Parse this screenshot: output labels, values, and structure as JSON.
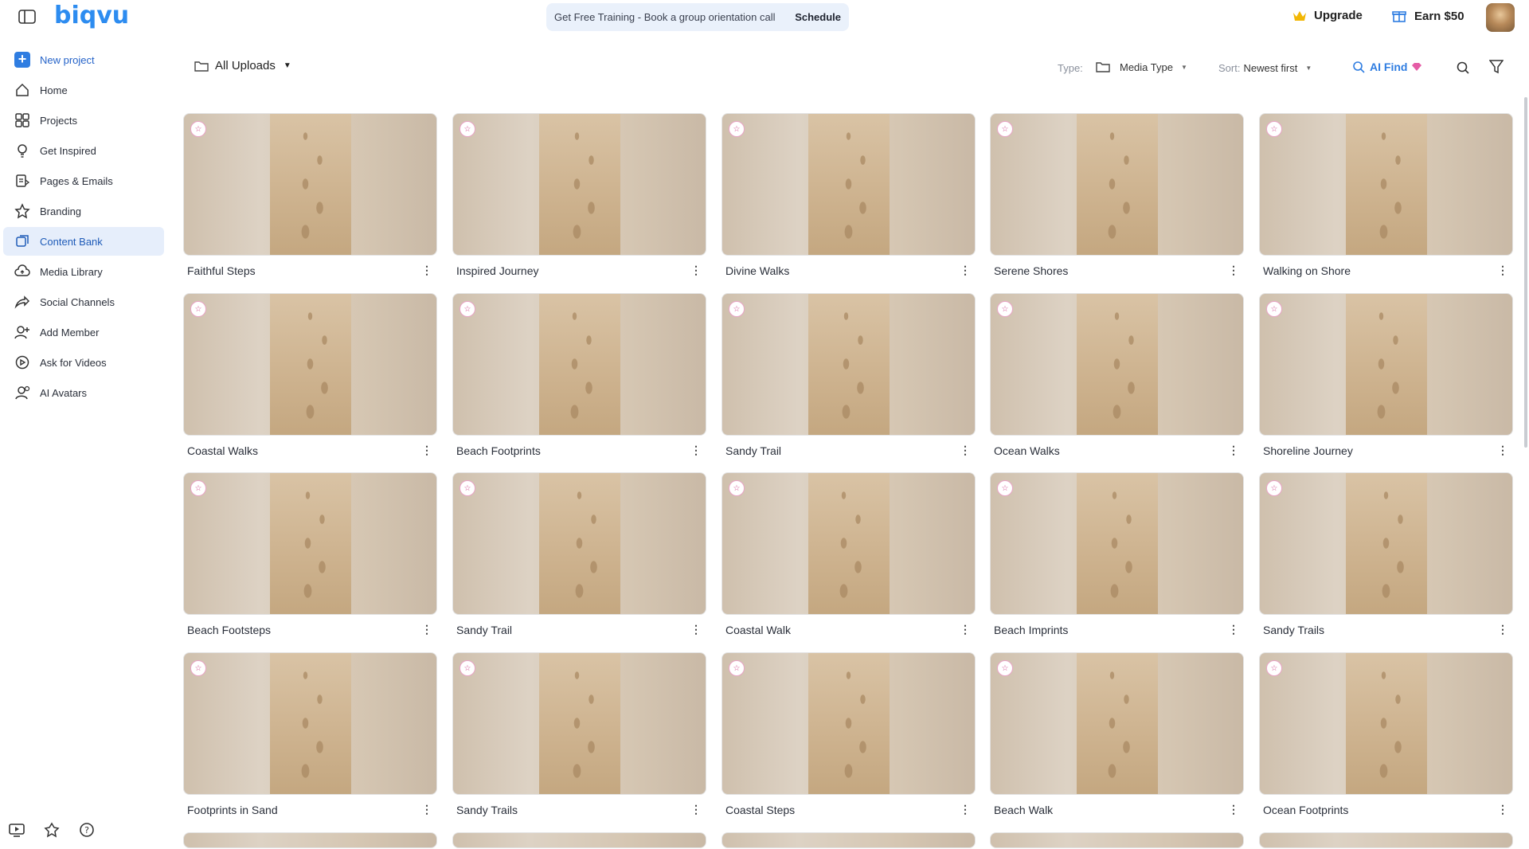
{
  "app": {
    "logo_text": "biqvu"
  },
  "banner": {
    "text": "Get Free Training - Book a group orientation call",
    "action": "Schedule"
  },
  "header": {
    "upgrade_label": "Upgrade",
    "earn_label": "Earn $50"
  },
  "sidebar": {
    "new_project": "New project",
    "items": [
      {
        "label": "Home",
        "icon": "home-icon"
      },
      {
        "label": "Projects",
        "icon": "grid-icon"
      },
      {
        "label": "Get Inspired",
        "icon": "lightbulb-icon"
      },
      {
        "label": "Pages & Emails",
        "icon": "pages-icon"
      },
      {
        "label": "Branding",
        "icon": "star-icon"
      },
      {
        "label": "Content Bank",
        "icon": "content-bank-icon",
        "active": true
      },
      {
        "label": "Media Library",
        "icon": "cloud-icon"
      },
      {
        "label": "Social Channels",
        "icon": "share-icon"
      },
      {
        "label": "Add Member",
        "icon": "add-user-icon"
      },
      {
        "label": "Ask for Videos",
        "icon": "video-request-icon"
      },
      {
        "label": "AI Avatars",
        "icon": "ai-avatar-icon"
      }
    ],
    "bottom_icons": [
      "screen-record-icon",
      "badge-icon",
      "help-icon"
    ]
  },
  "toolbar": {
    "folder_label": "All Uploads",
    "type_label": "Type:",
    "media_type": "Media Type",
    "sort_label": "Sort:",
    "sort_value": "Newest first",
    "ai_find_label": "AI Find"
  },
  "colors": {
    "accent": "#2f7de1",
    "active_bg": "#e6eefb",
    "banner_bg": "#eaf1fb"
  },
  "cards": [
    "Faithful Steps",
    "Inspired Journey",
    "Divine Walks",
    "Serene Shores",
    "Walking on Shore",
    "Coastal Walks",
    "Beach Footprints",
    "Sandy Trail",
    "Ocean Walks",
    "Shoreline Journey",
    "Beach Footsteps",
    "Sandy Trail",
    "Coastal Walk",
    "Beach Imprints",
    "Sandy Trails",
    "Footprints in Sand",
    "Sandy Trails",
    "Coastal Steps",
    "Beach Walk",
    "Ocean Footprints"
  ]
}
